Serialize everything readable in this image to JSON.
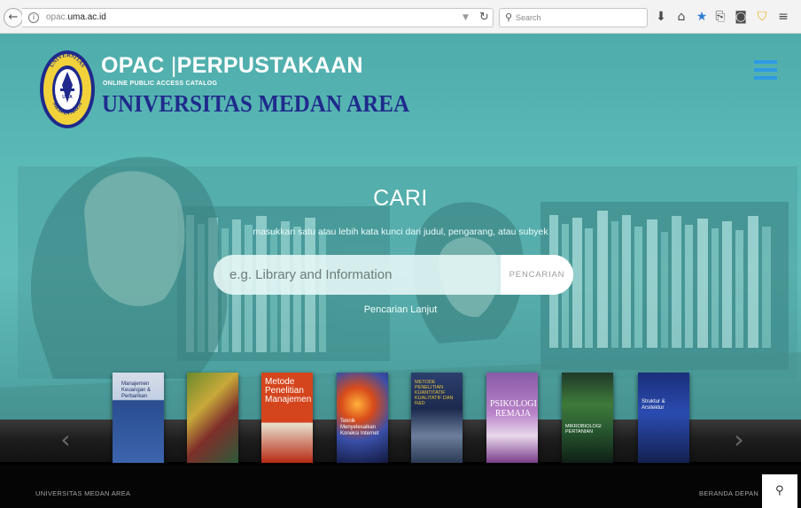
{
  "browser": {
    "url_host": "opac.",
    "url_domain": "uma.ac.id",
    "search_placeholder": "Search"
  },
  "brand": {
    "title": "OPAC",
    "separator": "|",
    "title_suffix": "PERPUSTAKAAN",
    "subtitle": "ONLINE PUBLIC ACCESS CATALOG",
    "university": "UNIVERSITAS MEDAN AREA",
    "seal_top": "UNIVERSITAS",
    "seal_bottom": "MEDAN AREA",
    "seal_center": "UMA"
  },
  "hero": {
    "title": "CARI",
    "description": "masukkan satu atau lebih kata kunci dari judul, pengarang, atau subyek",
    "search_placeholder": "e.g. Library and Information",
    "search_button": "PENCARIAN",
    "advanced_link": "Pencarian Lanjut"
  },
  "carousel": {
    "prev_icon": "chevron-left-icon",
    "next_icon": "chevron-right-icon",
    "books": [
      {
        "title": "Manajemen Keuangan & Perbankan",
        "color": "#2a4d8f"
      },
      {
        "title": "",
        "color": "#6b8a2a"
      },
      {
        "title": "Metode Penelitian Manajemen",
        "color": "#d4451d"
      },
      {
        "title": "Teknik Menyelesaikan Koneksi Internet",
        "color": "#1b2a5e"
      },
      {
        "title": "METODE PENELITIAN KUANTITATIF KUALITATIF DAN R&D",
        "color": "#2c3f6e"
      },
      {
        "title": "PSIKOLOGI REMAJA",
        "color": "#8a5aa8"
      },
      {
        "title": "MIKROBIOLOGI PERTANIAN",
        "color": "#1f3a2a"
      },
      {
        "title": "Struktur & Arsitektur",
        "color": "#1a2f7a"
      }
    ]
  },
  "footer": {
    "left": "UNIVERSITAS MEDAN AREA",
    "right": "BERANDA DEPAN"
  },
  "colors": {
    "accent": "#2e9be3",
    "brand_blue": "#1f2a8c",
    "hero_teal": "#5ab8b6"
  }
}
